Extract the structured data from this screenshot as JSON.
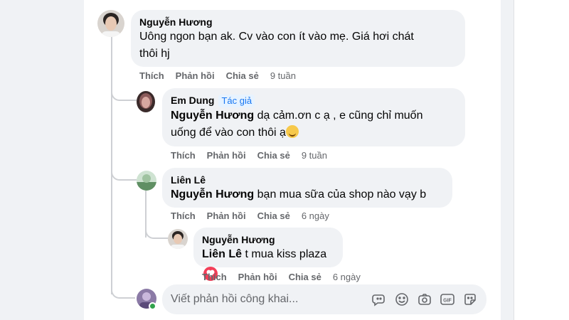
{
  "comments": [
    {
      "author": "Nguyễn Hương",
      "text_line1": "Uông ngon bạn ak. Cv vào con ít vào mẹ. Giá hơi chát",
      "text_line2": "thôi hj",
      "actions": {
        "like": "Thích",
        "reply": "Phản hồi",
        "share": "Chia sẻ",
        "time": "9 tuần"
      }
    },
    {
      "author": "Em Dung",
      "badge": "Tác giả",
      "mention": "Nguyễn Hương",
      "text_line1": "dạ cảm.ơn c ạ , e cũng chỉ muốn",
      "text_line2": "uống để vào con thôi ạ",
      "actions": {
        "like": "Thích",
        "reply": "Phản hồi",
        "share": "Chia sẻ",
        "time": "9 tuần"
      }
    },
    {
      "author": "Liên Lê",
      "mention": "Nguyễn Hương",
      "text": "bạn mua sữa của shop nào vạy b",
      "actions": {
        "like": "Thích",
        "reply": "Phản hồi",
        "share": "Chia sẻ",
        "time": "6 ngày"
      }
    },
    {
      "author": "Nguyễn Hương",
      "mention": "Liên Lê",
      "text": "t mua kiss plaza",
      "actions": {
        "like": "Thích",
        "reply": "Phản hồi",
        "share": "Chia sẻ",
        "time": "6 ngày"
      }
    }
  ],
  "reply_box": {
    "placeholder": "Viết phản hồi công khai...",
    "tools": [
      "sticker-face-icon",
      "emoji-icon",
      "camera-icon",
      "gif-icon",
      "sticker-icon"
    ]
  },
  "colors": {
    "badge": "#1877f2",
    "bubble": "#f0f2f5",
    "meta": "#65676b",
    "heart": "#f33e58",
    "online": "#31a24c"
  }
}
